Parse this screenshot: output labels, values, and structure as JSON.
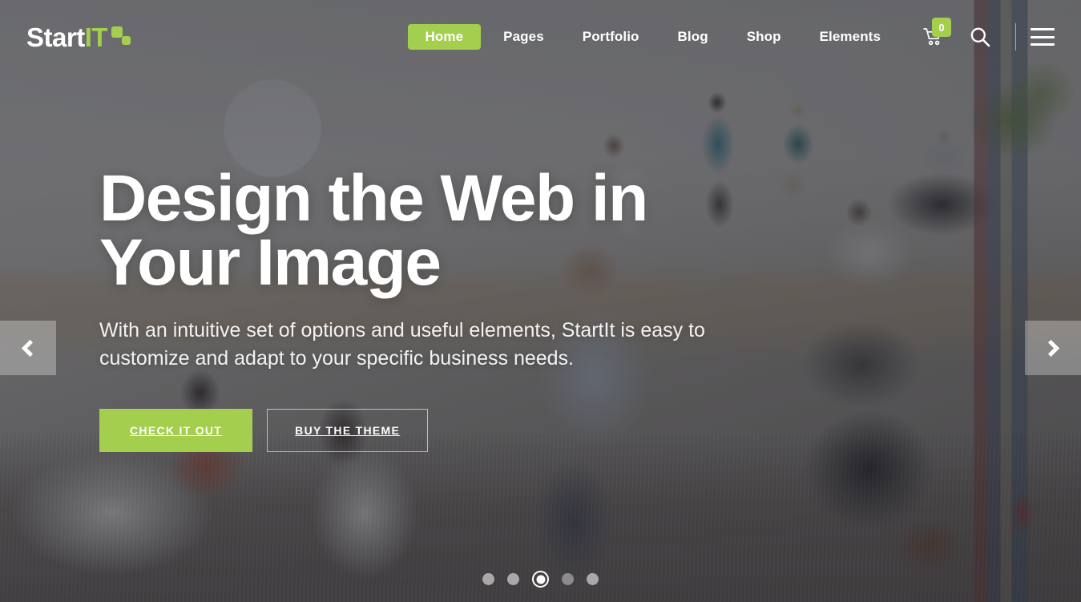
{
  "site": {
    "logo": {
      "part1": "Start",
      "part2": "IT",
      "accent_color": "#a4ce4e"
    }
  },
  "header": {
    "nav": [
      {
        "label": "Home",
        "active": true
      },
      {
        "label": "Pages",
        "active": false
      },
      {
        "label": "Portfolio",
        "active": false
      },
      {
        "label": "Blog",
        "active": false
      },
      {
        "label": "Shop",
        "active": false
      },
      {
        "label": "Elements",
        "active": false
      }
    ],
    "cart": {
      "icon": "shopping-cart-icon",
      "count": "0"
    },
    "search": {
      "icon": "search-icon"
    },
    "menu_toggle": {
      "icon": "hamburger-menu-icon"
    }
  },
  "slide": {
    "title_line1": "Design the Web in",
    "title_line2": "Your Image",
    "subtitle": "With an intuitive set of options and useful elements, StartIt is easy to customize and adapt to your specific business needs.",
    "primary_button": "CHECK IT OUT",
    "secondary_button": "BUY THE THEME"
  },
  "slider": {
    "prev_icon": "chevron-left-icon",
    "next_icon": "chevron-right-icon",
    "dots_total": 5,
    "active_dot_index": 3
  },
  "colors": {
    "accent_green": "#a4ce4e",
    "overlay": "rgba(38,40,48,0.60)",
    "text_white": "#ffffff"
  }
}
